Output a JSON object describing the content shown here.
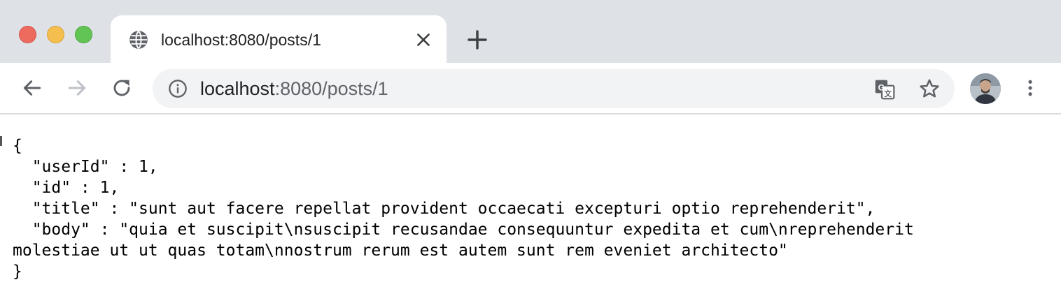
{
  "window_controls": {
    "close_color": "#ed6a5e",
    "minimize_color": "#f5bf4f",
    "maximize_color": "#61c454"
  },
  "tab": {
    "title": "localhost:8080/posts/1",
    "favicon": "globe-icon"
  },
  "toolbar": {
    "back_icon": "arrow-left-icon",
    "forward_icon": "arrow-right-icon",
    "reload_icon": "reload-icon",
    "address": {
      "host": "localhost",
      "rest": ":8080/posts/1",
      "info_icon": "info-icon",
      "translate_icon": "translate-icon",
      "bookmark_icon": "star-icon"
    },
    "profile_icon": "avatar",
    "menu_icon": "kebab-menu-icon"
  },
  "page": {
    "json_lines": [
      "{",
      "  \"userId\" : 1,",
      "  \"id\" : 1,",
      "  \"title\" : \"sunt aut facere repellat provident occaecati excepturi optio reprehenderit\",",
      "  \"body\" : \"quia et suscipit\\nsuscipit recusandae consequuntur expedita et cum\\nreprehenderit",
      "molestiae ut ut quas totam\\nnostrum rerum est autem sunt rem eveniet architecto\"",
      "}"
    ]
  }
}
